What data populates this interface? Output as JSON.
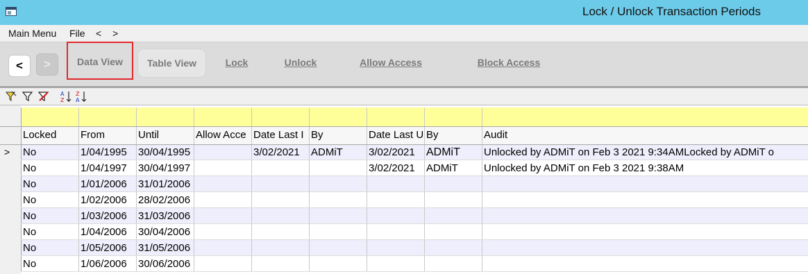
{
  "window": {
    "title": "Lock / Unlock Transaction Periods"
  },
  "menu": {
    "items": [
      "Main Menu",
      "File",
      "<",
      ">"
    ]
  },
  "toolbar": {
    "back": "<",
    "forward": ">",
    "data_view": "Data View",
    "table_view": "Table View",
    "lock": "Lock",
    "unlock": "Unlock",
    "allow_access": "Allow Access",
    "block_access": "Block Access"
  },
  "filter_icons": [
    "filter-apply-icon",
    "filter-icon",
    "filter-clear-icon",
    "sort-ascending-icon",
    "sort-descending-icon"
  ],
  "colors": {
    "titlebar": "#6ccbe9",
    "filter_row": "#ffff99",
    "alt_row": "#eeeefc",
    "selected_row": "#eeeefc",
    "highlight": "#e0282d"
  },
  "table": {
    "columns": [
      "Locked",
      "From",
      "Until",
      "Allow Acce",
      "Date Last I",
      "By",
      "Date Last U",
      "By",
      "Audit"
    ],
    "current_row_marker": ">",
    "rows": [
      [
        "No",
        "1/04/1995",
        "30/04/1995",
        "",
        "3/02/2021",
        "ADMiT",
        "3/02/2021",
        "ADMiT",
        "Unlocked by ADMiT on Feb  3 2021  9:34AMLocked by ADMiT o"
      ],
      [
        "No",
        "1/04/1997",
        "30/04/1997",
        "",
        "",
        "",
        "3/02/2021",
        "ADMiT",
        "Unlocked by ADMiT on Feb  3 2021  9:38AM"
      ],
      [
        "No",
        "1/01/2006",
        "31/01/2006",
        "",
        "",
        "",
        "",
        "",
        ""
      ],
      [
        "No",
        "1/02/2006",
        "28/02/2006",
        "",
        "",
        "",
        "",
        "",
        ""
      ],
      [
        "No",
        "1/03/2006",
        "31/03/2006",
        "",
        "",
        "",
        "",
        "",
        ""
      ],
      [
        "No",
        "1/04/2006",
        "30/04/2006",
        "",
        "",
        "",
        "",
        "",
        ""
      ],
      [
        "No",
        "1/05/2006",
        "31/05/2006",
        "",
        "",
        "",
        "",
        "",
        ""
      ],
      [
        "No",
        "1/06/2006",
        "30/06/2006",
        "",
        "",
        "",
        "",
        "",
        ""
      ]
    ]
  }
}
